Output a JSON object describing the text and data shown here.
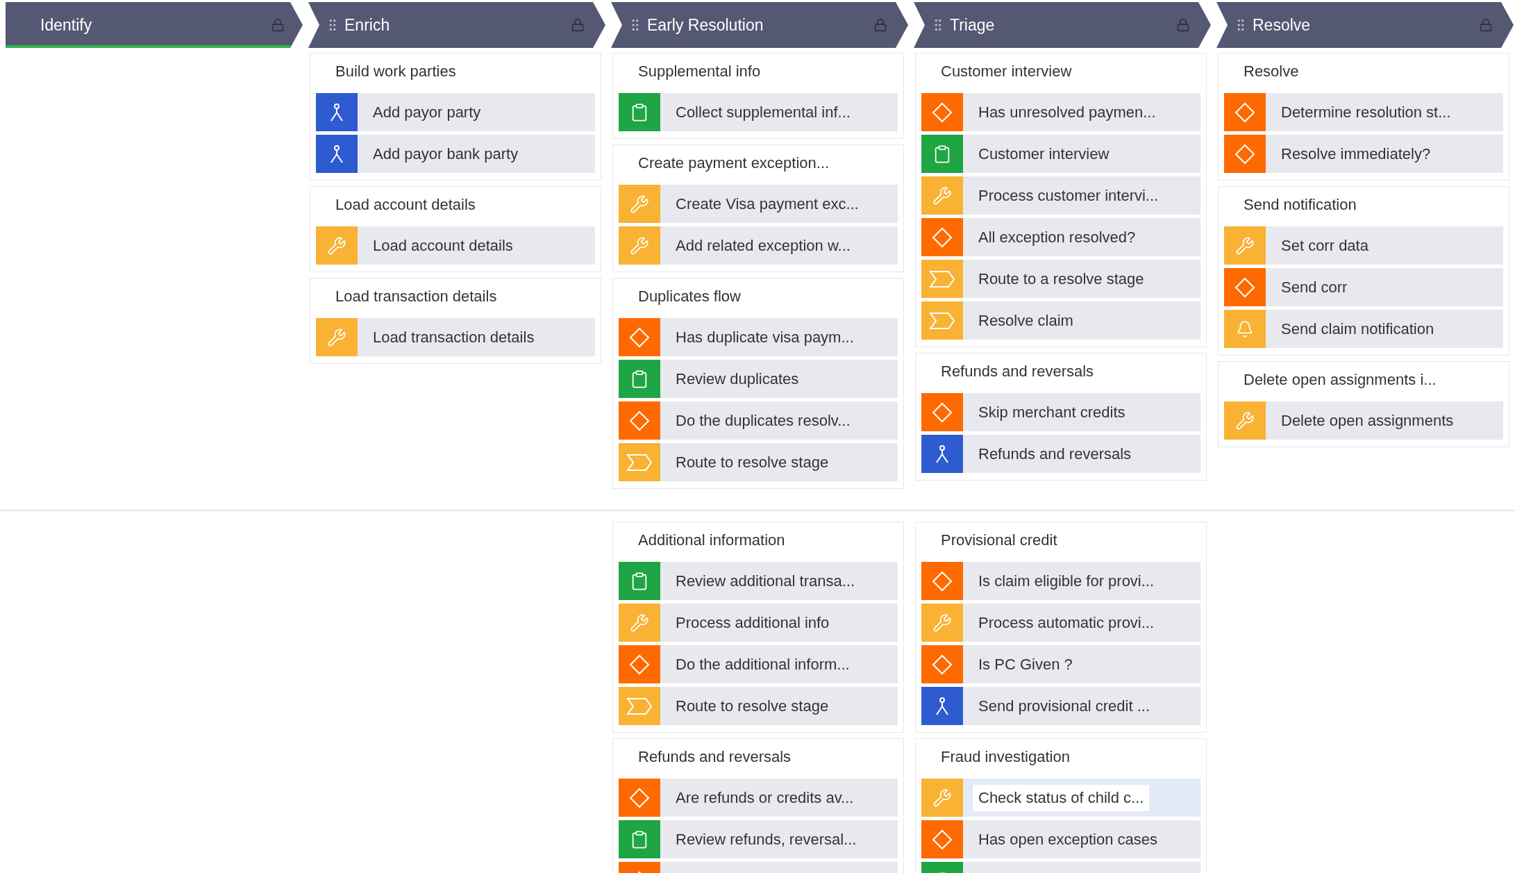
{
  "stages": [
    {
      "label": "Identify",
      "selected": true,
      "draggable": false
    },
    {
      "label": "Enrich",
      "selected": false,
      "draggable": true,
      "upper_cards": [
        {
          "title": "Build work parties",
          "steps": [
            {
              "kind": "subprocess",
              "label": "Add payor party",
              "selected": false
            },
            {
              "kind": "subprocess",
              "label": "Add payor bank party",
              "selected": false
            }
          ]
        },
        {
          "title": "Load account details",
          "steps": [
            {
              "kind": "utility",
              "label": "Load account details",
              "selected": false
            }
          ]
        },
        {
          "title": "Load transaction details",
          "steps": [
            {
              "kind": "utility",
              "label": "Load transaction details",
              "selected": false
            }
          ]
        }
      ]
    },
    {
      "label": "Early Resolution",
      "selected": false,
      "draggable": true,
      "upper_cards": [
        {
          "title": "Supplemental info",
          "steps": [
            {
              "kind": "assignment",
              "label": "Collect supplemental inf...",
              "selected": false
            }
          ]
        },
        {
          "title": "Create payment exception...",
          "steps": [
            {
              "kind": "utility",
              "label": "Create Visa payment exc...",
              "selected": false
            },
            {
              "kind": "utility",
              "label": "Add related exception w...",
              "selected": false
            }
          ]
        },
        {
          "title": "Duplicates flow",
          "steps": [
            {
              "kind": "decision",
              "label": "Has duplicate visa paym...",
              "selected": false
            },
            {
              "kind": "assignment",
              "label": "Review duplicates",
              "selected": false
            },
            {
              "kind": "decision",
              "label": "Do the duplicates resolv...",
              "selected": false
            },
            {
              "kind": "route",
              "label": "Route to resolve stage",
              "selected": false
            }
          ]
        }
      ],
      "lower_cards": [
        {
          "title": "Additional information",
          "steps": [
            {
              "kind": "assignment",
              "label": "Review additional transa...",
              "selected": false
            },
            {
              "kind": "utility",
              "label": "Process additional info",
              "selected": false
            },
            {
              "kind": "decision",
              "label": "Do the additional inform...",
              "selected": false
            },
            {
              "kind": "route",
              "label": "Route to resolve stage",
              "selected": false
            }
          ]
        },
        {
          "title": "Refunds and reversals",
          "steps": [
            {
              "kind": "decision",
              "label": "Are refunds or credits av...",
              "selected": false
            },
            {
              "kind": "assignment",
              "label": "Review refunds, reversal...",
              "selected": false
            },
            {
              "kind": "decision"
            }
          ]
        }
      ]
    },
    {
      "label": "Triage",
      "selected": false,
      "draggable": true,
      "upper_cards": [
        {
          "title": "Customer interview",
          "steps": [
            {
              "kind": "decision",
              "label": "Has unresolved paymen...",
              "selected": false
            },
            {
              "kind": "assignment",
              "label": "Customer interview",
              "selected": false
            },
            {
              "kind": "utility",
              "label": "Process customer intervi...",
              "selected": false
            },
            {
              "kind": "decision",
              "label": "All exception resolved?",
              "selected": false
            },
            {
              "kind": "route",
              "label": "Route to a resolve stage",
              "selected": false
            },
            {
              "kind": "route",
              "label": "Resolve claim",
              "selected": false
            }
          ]
        },
        {
          "title": "Refunds and reversals",
          "steps": [
            {
              "kind": "decision",
              "label": "Skip merchant credits",
              "selected": false
            },
            {
              "kind": "subprocess",
              "label": "Refunds and reversals",
              "selected": false
            }
          ]
        }
      ],
      "lower_cards": [
        {
          "title": "Provisional credit",
          "steps": [
            {
              "kind": "decision",
              "label": "Is claim eligible for provi...",
              "selected": false
            },
            {
              "kind": "utility",
              "label": "Process automatic provi...",
              "selected": false
            },
            {
              "kind": "decision",
              "label": "Is PC Given ?",
              "selected": false
            },
            {
              "kind": "subprocess",
              "label": "Send provisional credit ...",
              "selected": false
            }
          ]
        },
        {
          "title": "Fraud investigation",
          "steps": [
            {
              "kind": "utility",
              "label": "Check status of child c...",
              "selected": true
            },
            {
              "kind": "decision",
              "label": "Has open exception cases",
              "selected": false
            },
            {
              "kind": "assignment"
            }
          ]
        }
      ]
    },
    {
      "label": "Resolve",
      "selected": false,
      "draggable": true,
      "upper_cards": [
        {
          "title": "Resolve",
          "steps": [
            {
              "kind": "decision",
              "label": "Determine resolution st...",
              "selected": false
            },
            {
              "kind": "decision",
              "label": "Resolve immediately?",
              "selected": false
            }
          ]
        },
        {
          "title": "Send notification",
          "steps": [
            {
              "kind": "utility",
              "label": "Set corr data",
              "selected": false
            },
            {
              "kind": "decision",
              "label": "Send corr",
              "selected": false
            },
            {
              "kind": "notify",
              "label": "Send claim notification",
              "selected": false
            }
          ]
        },
        {
          "title": "Delete open assignments i...",
          "steps": [
            {
              "kind": "utility",
              "label": "Delete open assignments",
              "selected": false
            }
          ]
        }
      ]
    }
  ]
}
